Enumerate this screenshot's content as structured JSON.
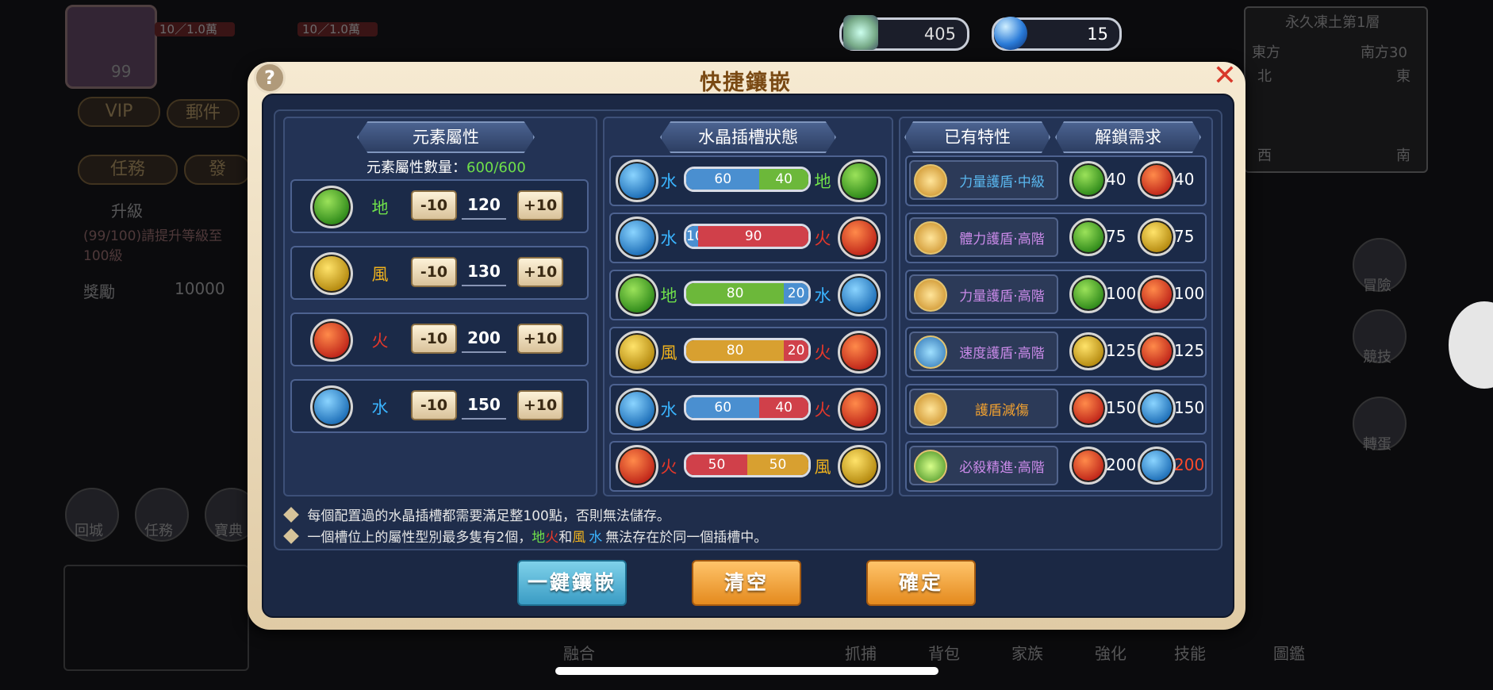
{
  "colors": {
    "earth": "#6fe04a",
    "wind": "#f0b21d",
    "fire": "#e8382a",
    "water": "#3ab4ff",
    "gold_text": "#7a4a14"
  },
  "resources": {
    "crystal_value": "405",
    "orb_value": "15"
  },
  "background": {
    "hp_bars": [
      "10／1.0萬",
      "10／1.0萬"
    ],
    "level": "99",
    "vip": "VIP",
    "mail": "郵件",
    "tab_tasks": "任務",
    "tab_other": "發",
    "quest_title": "升級",
    "quest_desc": "(99/100)請提升等級至100級",
    "reward_label": "獎勵",
    "reward_value": "10000",
    "map_title": "永久凍土第1層",
    "map_dirs": [
      "東方",
      "南方30",
      "北",
      "東",
      "西",
      "南"
    ],
    "left_icons": [
      "回城",
      "任務",
      "寶典"
    ],
    "bottom_icons": [
      "融合",
      "抓捕",
      "背包",
      "家族",
      "強化",
      "技能",
      "圖鑑"
    ],
    "right_icons": [
      "冒險",
      "競技",
      "轉蛋"
    ]
  },
  "dialog": {
    "title": "快捷鑲嵌",
    "help_glyph": "?",
    "close_glyph": "✕",
    "attr_panel": {
      "header": "元素屬性",
      "count_label": "元素屬性數量：",
      "count_value": "600/600",
      "minus_label": "-10",
      "plus_label": "+10",
      "rows": [
        {
          "element": "earth",
          "label": "地",
          "value": "120"
        },
        {
          "element": "wind",
          "label": "風",
          "value": "130"
        },
        {
          "element": "fire",
          "label": "火",
          "value": "200"
        },
        {
          "element": "water",
          "label": "水",
          "value": "150"
        }
      ]
    },
    "slot_panel": {
      "header": "水晶插槽狀態",
      "slots": [
        {
          "left": "water",
          "left_label": "水",
          "left_val": 60,
          "right_val": 40,
          "right": "earth",
          "right_label": "地"
        },
        {
          "left": "water",
          "left_label": "水",
          "left_val": 10,
          "right_val": 90,
          "right": "fire",
          "right_label": "火"
        },
        {
          "left": "earth",
          "left_label": "地",
          "left_val": 80,
          "right_val": 20,
          "right": "water",
          "right_label": "水"
        },
        {
          "left": "wind",
          "left_label": "風",
          "left_val": 80,
          "right_val": 20,
          "right": "fire",
          "right_label": "火"
        },
        {
          "left": "water",
          "left_label": "水",
          "left_val": 60,
          "right_val": 40,
          "right": "fire",
          "right_label": "火"
        },
        {
          "left": "fire",
          "left_label": "火",
          "left_val": 50,
          "right_val": 50,
          "right": "wind",
          "right_label": "風"
        }
      ]
    },
    "trait_panel": {
      "header_owned": "已有特性",
      "header_unlock": "解鎖需求",
      "traits": [
        {
          "name": "力量護盾·中級",
          "color": "#5ab8f0",
          "icon": "fist-shield-icon",
          "req": [
            {
              "element": "earth",
              "value": "40"
            },
            {
              "element": "fire",
              "value": "40"
            }
          ]
        },
        {
          "name": "體力護盾·高階",
          "color": "#c98ae8",
          "icon": "heart-shield-icon",
          "req": [
            {
              "element": "earth",
              "value": "75"
            },
            {
              "element": "wind",
              "value": "75"
            }
          ]
        },
        {
          "name": "力量護盾·高階",
          "color": "#c98ae8",
          "icon": "fist-shield-icon",
          "req": [
            {
              "element": "earth",
              "value": "100"
            },
            {
              "element": "fire",
              "value": "100"
            }
          ]
        },
        {
          "name": "速度護盾·高階",
          "color": "#c98ae8",
          "icon": "speed-shield-icon",
          "req": [
            {
              "element": "wind",
              "value": "125"
            },
            {
              "element": "fire",
              "value": "125"
            }
          ]
        },
        {
          "name": "護盾減傷",
          "color": "#f0a030",
          "icon": "shield-reduce-icon",
          "req": [
            {
              "element": "fire",
              "value": "150"
            },
            {
              "element": "water",
              "value": "150"
            }
          ]
        },
        {
          "name": "必殺精進·高階",
          "color": "#c98ae8",
          "icon": "critical-icon",
          "req": [
            {
              "element": "fire",
              "value": "200"
            },
            {
              "element": "water",
              "value": "200",
              "highlight": "#ff4a2a"
            }
          ]
        }
      ]
    },
    "notes": {
      "line1": "每個配置過的水晶插槽都需要滿足整100點，否則無法儲存。",
      "line2_pre": "一個槽位上的屬性型別最多隻有2個，",
      "line2_earth": "地",
      "line2_fire": "火",
      "line2_and": "和",
      "line2_wind": "風",
      "line2_water": "水",
      "line2_post": "無法存在於同一個插槽中。"
    },
    "buttons": {
      "auto": "一鍵鑲嵌",
      "clear": "清空",
      "confirm": "確定"
    }
  }
}
